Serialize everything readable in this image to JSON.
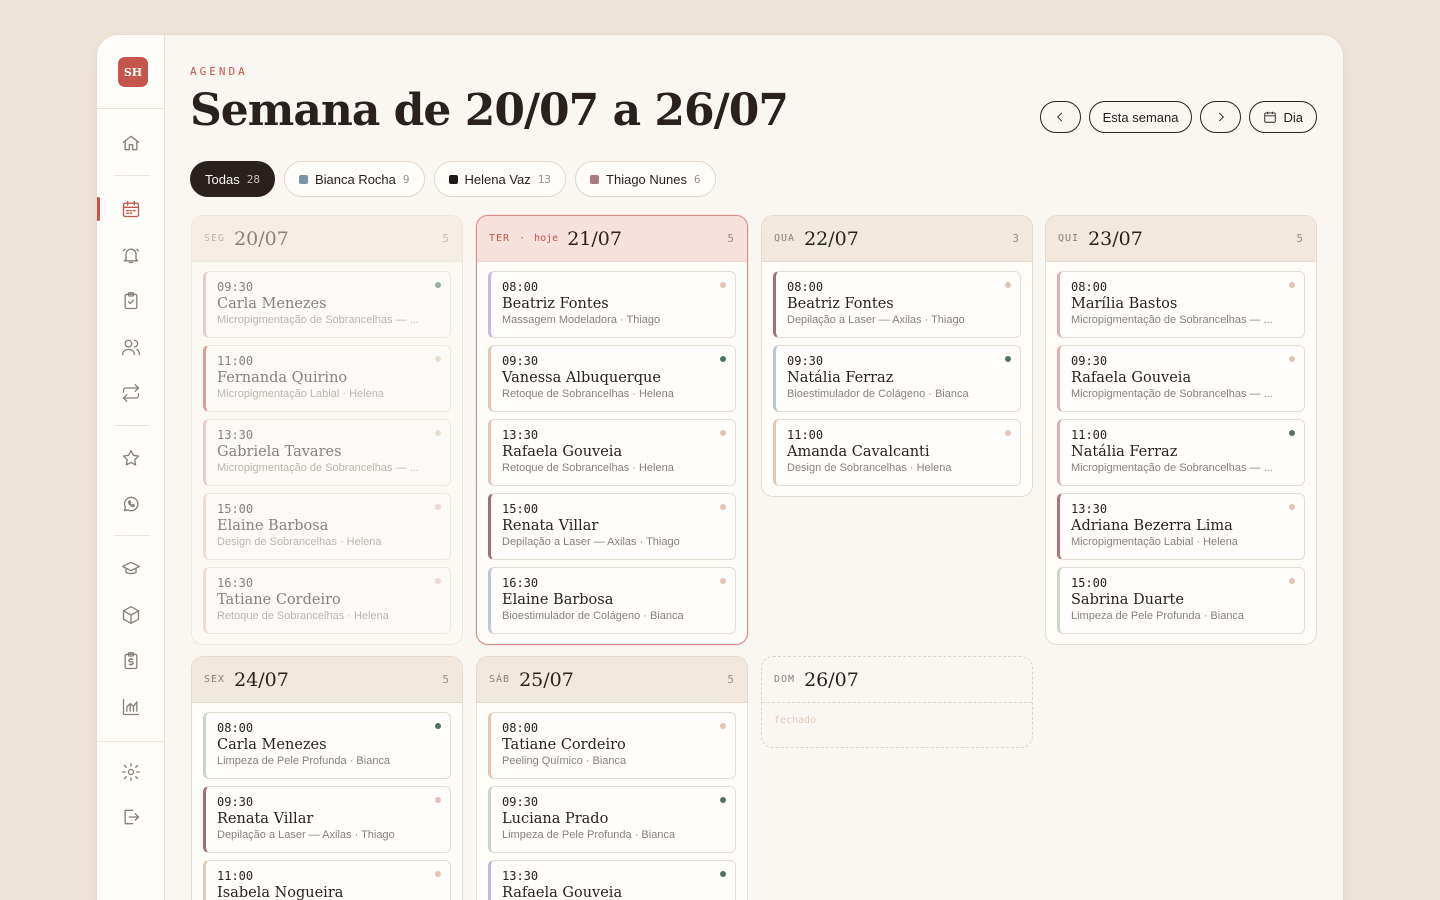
{
  "sidebar": {
    "logo": "SH",
    "items": [
      {
        "name": "home-icon"
      },
      {
        "name": "calendar-icon"
      },
      {
        "name": "bell-icon"
      },
      {
        "name": "clipboard-check-icon"
      },
      {
        "name": "users-icon"
      },
      {
        "name": "repeat-icon"
      },
      {
        "name": "star-icon"
      },
      {
        "name": "whatsapp-icon"
      },
      {
        "name": "graduation-cap-icon"
      },
      {
        "name": "package-icon"
      },
      {
        "name": "clipboard-dollar-icon"
      },
      {
        "name": "chart-icon"
      },
      {
        "name": "gear-icon"
      },
      {
        "name": "logout-icon"
      }
    ]
  },
  "header": {
    "eyebrow": "AGENDA",
    "title": "Semana de 20/07 a 26/07",
    "this_week": "Esta semana",
    "view_mode": "Dia"
  },
  "filters": [
    {
      "label": "Todas",
      "count": "28",
      "active": true,
      "color": ""
    },
    {
      "label": "Bianca Rocha",
      "count": "9",
      "active": false,
      "color": "#7a94a8"
    },
    {
      "label": "Helena Vaz",
      "count": "13",
      "active": false,
      "color": "#1f1a17"
    },
    {
      "label": "Thiago Nunes",
      "count": "6",
      "active": false,
      "color": "#a87a80"
    }
  ],
  "days": [
    {
      "dow": "SEG",
      "date": "20/07",
      "count": "5",
      "state": "past",
      "appointments": [
        {
          "time": "09:30",
          "client": "Carla Menezes",
          "service": "Micropigmentação de Sobrancelhas — ...",
          "status": "confirmed",
          "accent": "#d8a8a8"
        },
        {
          "time": "11:00",
          "client": "Fernanda Quirino",
          "service": "Micropigmentação Labial · Helena",
          "status": "pending",
          "accent": "#c4564b"
        },
        {
          "time": "13:30",
          "client": "Gabriela Tavares",
          "service": "Micropigmentação de Sobrancelhas — ...",
          "status": "pending",
          "accent": "#d8a8a8"
        },
        {
          "time": "15:00",
          "client": "Elaine Barbosa",
          "service": "Design de Sobrancelhas · Helena",
          "status": "pending",
          "accent": "#e8c8b8"
        },
        {
          "time": "16:30",
          "client": "Tatiane Cordeiro",
          "service": "Retoque de Sobrancelhas · Helena",
          "status": "pending",
          "accent": "#e8c8b8"
        }
      ]
    },
    {
      "dow": "TER",
      "today": "hoje",
      "date": "21/07",
      "count": "5",
      "state": "today",
      "appointments": [
        {
          "time": "08:00",
          "client": "Beatriz Fontes",
          "service": "Massagem Modeladora · Thiago",
          "status": "pending",
          "accent": "#c9b8d8"
        },
        {
          "time": "09:30",
          "client": "Vanessa Albuquerque",
          "service": "Retoque de Sobrancelhas · Helena",
          "status": "confirmed",
          "accent": "#e3c7b3"
        },
        {
          "time": "13:30",
          "client": "Rafaela Gouveia",
          "service": "Retoque de Sobrancelhas · Helena",
          "status": "pending",
          "accent": "#e3c7b3"
        },
        {
          "time": "15:00",
          "client": "Renata Villar",
          "service": "Depilação a Laser — Axilas · Thiago",
          "status": "pending",
          "accent": "#a56e72"
        },
        {
          "time": "16:30",
          "client": "Elaine Barbosa",
          "service": "Bioestimulador de Colágeno · Bianca",
          "status": "pending",
          "accent": "#b9c8d6"
        }
      ]
    },
    {
      "dow": "QUA",
      "date": "22/07",
      "count": "3",
      "state": "future",
      "appointments": [
        {
          "time": "08:00",
          "client": "Beatriz Fontes",
          "service": "Depilação a Laser — Axilas · Thiago",
          "status": "pending",
          "accent": "#a56e72"
        },
        {
          "time": "09:30",
          "client": "Natália Ferraz",
          "service": "Bioestimulador de Colágeno · Bianca",
          "status": "confirmed",
          "accent": "#b9c8d6"
        },
        {
          "time": "11:00",
          "client": "Amanda Cavalcanti",
          "service": "Design de Sobrancelhas · Helena",
          "status": "pending",
          "accent": "#e3c7b3"
        }
      ]
    },
    {
      "dow": "QUI",
      "date": "23/07",
      "count": "5",
      "state": "future",
      "appointments": [
        {
          "time": "08:00",
          "client": "Marília Bastos",
          "service": "Micropigmentação de Sobrancelhas — ...",
          "status": "pending",
          "accent": "#e0b0b0"
        },
        {
          "time": "09:30",
          "client": "Rafaela Gouveia",
          "service": "Micropigmentação de Sobrancelhas — ...",
          "status": "pending",
          "accent": "#e0b0b0"
        },
        {
          "time": "11:00",
          "client": "Natália Ferraz",
          "service": "Micropigmentação de Sobrancelhas — ...",
          "status": "confirmed",
          "accent": "#e0b0b0"
        },
        {
          "time": "13:30",
          "client": "Adriana Bezerra Lima",
          "service": "Micropigmentação Labial · Helena",
          "status": "pending",
          "accent": "#b96f76"
        },
        {
          "time": "15:00",
          "client": "Sabrina Duarte",
          "service": "Limpeza de Pele Profunda · Bianca",
          "status": "pending",
          "accent": "#c8d8c8"
        }
      ]
    },
    {
      "dow": "SEX",
      "date": "24/07",
      "count": "5",
      "state": "future",
      "appointments": [
        {
          "time": "08:00",
          "client": "Carla Menezes",
          "service": "Limpeza de Pele Profunda · Bianca",
          "status": "confirmed",
          "accent": "#c8d8c8"
        },
        {
          "time": "09:30",
          "client": "Renata Villar",
          "service": "Depilação a Laser — Axilas · Thiago",
          "status": "pending",
          "accent": "#a56e72"
        },
        {
          "time": "11:00",
          "client": "Isabela Nogueira",
          "service": "",
          "status": "pending",
          "accent": "#e3c7b3"
        }
      ]
    },
    {
      "dow": "SÁB",
      "date": "25/07",
      "count": "5",
      "state": "future",
      "appointments": [
        {
          "time": "08:00",
          "client": "Tatiane Cordeiro",
          "service": "Peeling Químico · Bianca",
          "status": "pending",
          "accent": "#e3c7b3"
        },
        {
          "time": "09:30",
          "client": "Luciana Prado",
          "service": "Limpeza de Pele Profunda · Bianca",
          "status": "confirmed",
          "accent": "#c8d8c8"
        },
        {
          "time": "13:30",
          "client": "Rafaela Gouveia",
          "service": "",
          "status": "confirmed",
          "accent": "#c9b8d8"
        }
      ]
    },
    {
      "dow": "DOM",
      "date": "26/07",
      "count": "",
      "state": "closed",
      "closed_label": "fechado",
      "appointments": []
    }
  ]
}
